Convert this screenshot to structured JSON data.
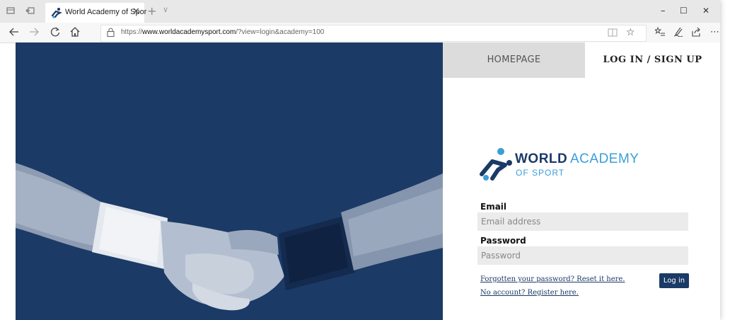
{
  "browser": {
    "tab_title": "World Academy of Spor",
    "url_prefix": "https://",
    "url_domain": "www.worldacademysport.com",
    "url_path": "/?view=login&academy=100",
    "window_minimize": "–",
    "window_maximize": "☐",
    "window_close": "✕",
    "tab_close": "✕",
    "new_tab": "+",
    "tab_dropdown": "∨"
  },
  "nav": {
    "homepage": "HOMEPAGE",
    "login_signup": "LOG IN / SIGN UP"
  },
  "logo": {
    "word_bold": "WORLD",
    "word_light": "ACADEMY",
    "sub": "OF SPORT"
  },
  "form": {
    "email_label": "Email",
    "email_placeholder": "Email address",
    "password_label": "Password",
    "password_placeholder": "Password",
    "forgot_link": "Forgotten your password? Reset it here.",
    "register_link": "No account? Register here.",
    "login_button": "Log in"
  },
  "colors": {
    "brand_navy": "#1b3a66",
    "brand_blue": "#3a9ed8"
  },
  "icons": {
    "hero_image": "handshake-photo",
    "browser": [
      "tab-list-icon",
      "back-tab-icon",
      "back-icon",
      "forward-icon",
      "refresh-icon",
      "home-icon",
      "lock-icon",
      "reading-view-icon",
      "favorite-star-icon",
      "favorites-icon",
      "pen-icon",
      "share-icon",
      "more-icon"
    ]
  }
}
